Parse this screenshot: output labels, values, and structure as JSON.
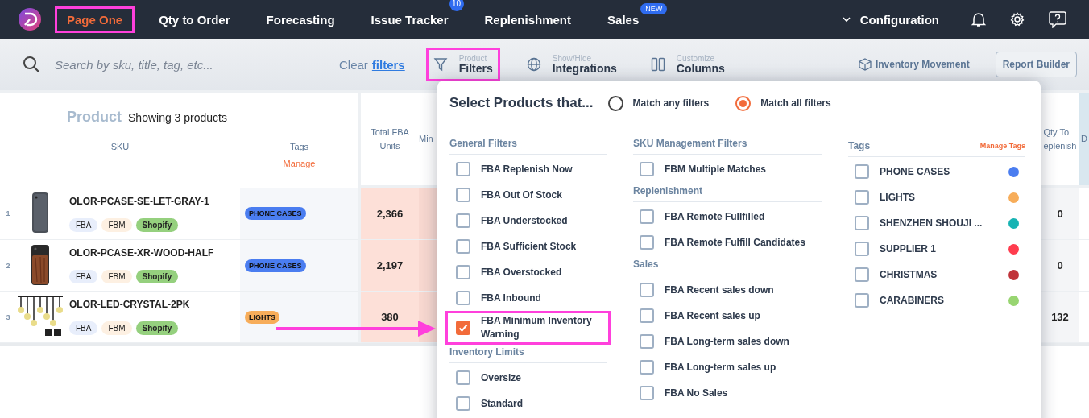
{
  "nav": {
    "items": [
      {
        "label": "Page One",
        "selected": true,
        "highlighted": true
      },
      {
        "label": "Qty to Order",
        "selected": false
      },
      {
        "label": "Forecasting",
        "selected": false
      },
      {
        "label": "Issue Tracker",
        "selected": false,
        "badge": {
          "text": "10",
          "kind": "count"
        }
      },
      {
        "label": "Replenishment",
        "selected": false
      },
      {
        "label": "Sales",
        "selected": false,
        "badge": {
          "text": "NEW",
          "kind": "pill"
        }
      }
    ],
    "configuration": "Configuration"
  },
  "toolbar": {
    "search_placeholder": "Search by sku, title, tag, etc...",
    "clear_text": "Clear",
    "clear_link": "filters",
    "tools": [
      {
        "kind": "filter",
        "caption": "Product",
        "label": "Filters",
        "highlighted": true
      },
      {
        "kind": "globe",
        "caption": "Show/Hide",
        "label": "Integrations",
        "highlighted": false
      },
      {
        "kind": "columns",
        "caption": "Customize",
        "label": "Columns",
        "highlighted": false
      }
    ],
    "inventory_movement": "Inventory Movement",
    "report_builder": "Report Builder"
  },
  "table": {
    "title": "Product",
    "count": "Showing 3 products",
    "sku_header": "SKU",
    "tags_header": "Tags",
    "tags_action": "Manage",
    "total_header": "Total FBA Units",
    "min_header": "Min",
    "qty_header": [
      "Qty To",
      "eplenish"
    ],
    "last_header": "D",
    "rows": [
      {
        "index": "1",
        "sku": "OLOR-PCASE-SE-LET-GRAY-1",
        "channels": [
          {
            "label": "FBA",
            "kind": "fba"
          },
          {
            "label": "FBM",
            "kind": "fbm"
          },
          {
            "label": "Shopify",
            "kind": "shopify"
          }
        ],
        "tag": {
          "label": "PHONE CASES",
          "color": "#4a7df0"
        },
        "total": "2,366",
        "qty": "0"
      },
      {
        "index": "2",
        "sku": "OLOR-PCASE-XR-WOOD-HALF",
        "channels": [
          {
            "label": "FBA",
            "kind": "fba"
          },
          {
            "label": "FBM",
            "kind": "fbm"
          },
          {
            "label": "Shopify",
            "kind": "shopify"
          }
        ],
        "tag": {
          "label": "PHONE CASES",
          "color": "#4a7df0"
        },
        "total": "2,197",
        "qty": "0"
      },
      {
        "index": "3",
        "sku": "OLOR-LED-CRYSTAL-2PK",
        "channels": [
          {
            "label": "FBA",
            "kind": "fba"
          },
          {
            "label": "FBM",
            "kind": "fbm"
          },
          {
            "label": "Shopify",
            "kind": "shopify"
          }
        ],
        "tag": {
          "label": "LIGHTS",
          "color": "#f7ad5a"
        },
        "total": "380",
        "qty": "132"
      }
    ]
  },
  "dropdown": {
    "title": "Select Products that...",
    "match_options": [
      {
        "label": "Match any filters",
        "selected": false
      },
      {
        "label": "Match all filters",
        "selected": true
      }
    ],
    "columns": [
      [
        {
          "heading": "General Filters",
          "items": [
            {
              "label": "FBA Replenish Now",
              "checked": false
            },
            {
              "label": "FBA Out Of Stock",
              "checked": false
            },
            {
              "label": "FBA Understocked",
              "checked": false
            },
            {
              "label": "FBA Sufficient Stock",
              "checked": false
            },
            {
              "label": "FBA Overstocked",
              "checked": false
            },
            {
              "label": "FBA Inbound",
              "checked": false
            },
            {
              "label": "FBA Minimum Inventory Warning",
              "checked": true,
              "highlighted": true
            }
          ]
        },
        {
          "heading": "Inventory Limits",
          "items": [
            {
              "label": "Oversize",
              "checked": false
            },
            {
              "label": "Standard",
              "checked": false
            }
          ]
        }
      ],
      [
        {
          "heading": "SKU Management Filters",
          "items": [
            {
              "label": "FBM Multiple Matches",
              "checked": false
            }
          ]
        },
        {
          "heading": "Replenishment",
          "items": [
            {
              "label": "FBA Remote Fullfilled",
              "checked": false
            },
            {
              "label": "FBA Remote Fulfill Candidates",
              "checked": false
            }
          ]
        },
        {
          "heading": "Sales",
          "items": [
            {
              "label": "FBA Recent sales down",
              "checked": false
            },
            {
              "label": "FBA Recent sales up",
              "checked": false
            },
            {
              "label": "FBA Long-term sales down",
              "checked": false
            },
            {
              "label": "FBA Long-term sales up",
              "checked": false
            },
            {
              "label": "FBA No Sales",
              "checked": false
            }
          ]
        }
      ]
    ],
    "tags": {
      "heading": "Tags",
      "action": "Manage Tags",
      "items": [
        {
          "label": "PHONE CASES",
          "checked": false,
          "color": "#4a7df0"
        },
        {
          "label": "LIGHTS",
          "checked": false,
          "color": "#f7ad5a"
        },
        {
          "label": "SHENZHEN SHOUJI ...",
          "checked": false,
          "color": "#17b3b3"
        },
        {
          "label": "SUPPLIER 1",
          "checked": false,
          "color": "#ff3c4e"
        },
        {
          "label": "CHRISTMAS",
          "checked": false,
          "color": "#c0343a"
        },
        {
          "label": "CARABINERS",
          "checked": false,
          "color": "#98d571"
        }
      ]
    }
  }
}
